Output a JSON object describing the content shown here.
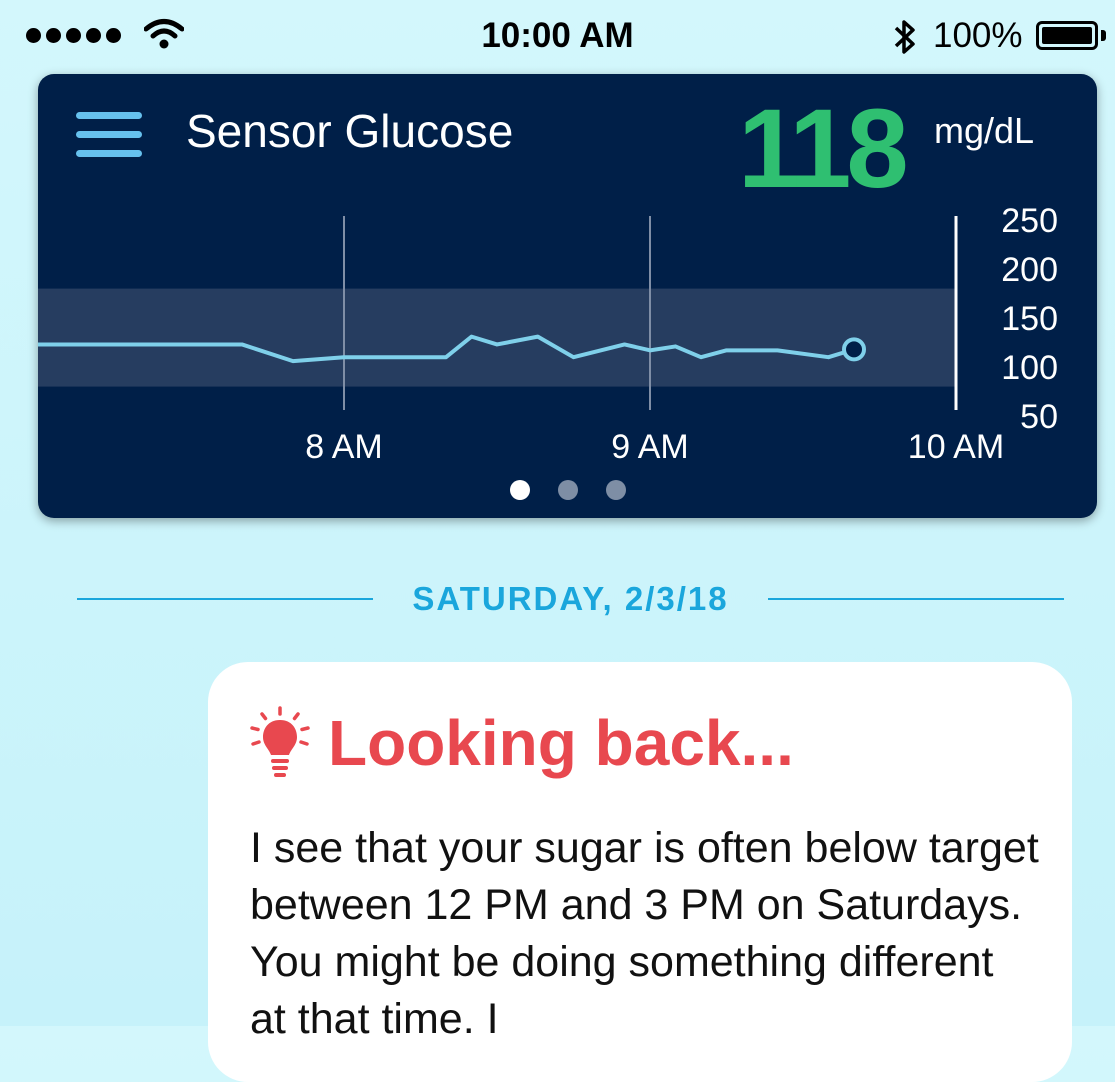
{
  "status_bar": {
    "time": "10:00 AM",
    "battery_percent": "100%",
    "signal_bars": 5,
    "icons": [
      "signal-dots-icon",
      "wifi-icon",
      "bluetooth-icon",
      "battery-icon"
    ]
  },
  "glucose_card": {
    "title": "Sensor Glucose",
    "reading": "118",
    "unit": "mg/dL",
    "page_count": 3,
    "active_page": 1
  },
  "chart_data": {
    "type": "line",
    "x": [
      "7:35",
      "7:40",
      "7:50",
      "8:00",
      "8:10",
      "8:20",
      "8:25",
      "8:30",
      "8:38",
      "8:45",
      "8:55",
      "9:00",
      "9:05",
      "9:10",
      "9:15",
      "9:25",
      "9:35",
      "9:40"
    ],
    "values": [
      123,
      123,
      106,
      110,
      110,
      110,
      131,
      123,
      131,
      110,
      123,
      117,
      121,
      110,
      117,
      117,
      110,
      118
    ],
    "ylim": [
      50,
      250
    ],
    "yticks": [
      "250",
      "200",
      "150",
      "100",
      "50"
    ],
    "xticks": [
      "8 AM",
      "9 AM",
      "10 AM"
    ],
    "target_range": [
      80,
      180
    ],
    "current_value": 118,
    "colors": {
      "line": "#7fd0ea",
      "target_band": "#263d60",
      "reading": "#2fbf71"
    }
  },
  "date_divider": {
    "label": "SATURDAY, 2/3/18"
  },
  "insight_card": {
    "icon": "lightbulb-icon",
    "title": "Looking back...",
    "body": "I see that your sugar is often below target between 12 PM and 3 PM on Saturdays. You might be doing something different at that time. I"
  },
  "colors": {
    "card_bg": "#001f48",
    "accent_blue": "#1aa6dc",
    "alert_red": "#e8484f"
  }
}
